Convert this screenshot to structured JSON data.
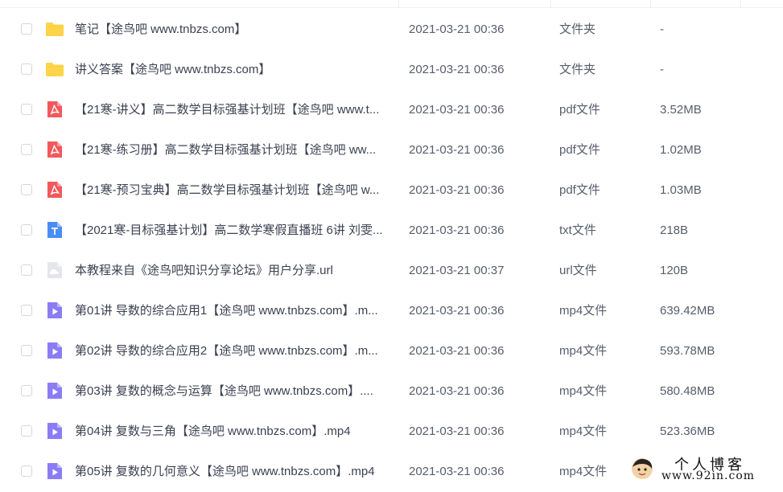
{
  "files": [
    {
      "icon": "folder-icon",
      "name": "笔记【途鸟吧 www.tnbzs.com】",
      "modified": "2021-03-21 00:36",
      "type": "文件夹",
      "size": "-"
    },
    {
      "icon": "folder-icon",
      "name": "讲义答案【途鸟吧 www.tnbzs.com】",
      "modified": "2021-03-21 00:36",
      "type": "文件夹",
      "size": "-"
    },
    {
      "icon": "pdf-icon",
      "name": "【21寒-讲义】高二数学目标强基计划班【途鸟吧 www.t...",
      "modified": "2021-03-21 00:36",
      "type": "pdf文件",
      "size": "3.52MB"
    },
    {
      "icon": "pdf-icon",
      "name": "【21寒-练习册】高二数学目标强基计划班【途鸟吧 ww...",
      "modified": "2021-03-21 00:36",
      "type": "pdf文件",
      "size": "1.02MB"
    },
    {
      "icon": "pdf-icon",
      "name": "【21寒-预习宝典】高二数学目标强基计划班【途鸟吧 w...",
      "modified": "2021-03-21 00:36",
      "type": "pdf文件",
      "size": "1.03MB"
    },
    {
      "icon": "txt-icon",
      "name": "【2021寒-目标强基计划】高二数学寒假直播班 6讲 刘雯...",
      "modified": "2021-03-21 00:36",
      "type": "txt文件",
      "size": "218B"
    },
    {
      "icon": "url-file-icon",
      "name": "本教程来自《途鸟吧知识分享论坛》用户分享.url",
      "modified": "2021-03-21 00:37",
      "type": "url文件",
      "size": "120B"
    },
    {
      "icon": "video-icon",
      "name": "第01讲 导数的综合应用1【途鸟吧 www.tnbzs.com】.m...",
      "modified": "2021-03-21 00:36",
      "type": "mp4文件",
      "size": "639.42MB"
    },
    {
      "icon": "video-icon",
      "name": "第02讲 导数的综合应用2【途鸟吧 www.tnbzs.com】.m...",
      "modified": "2021-03-21 00:36",
      "type": "mp4文件",
      "size": "593.78MB"
    },
    {
      "icon": "video-icon",
      "name": "第03讲 复数的概念与运算【途鸟吧 www.tnbzs.com】....",
      "modified": "2021-03-21 00:36",
      "type": "mp4文件",
      "size": "580.48MB"
    },
    {
      "icon": "video-icon",
      "name": "第04讲 复数与三角【途鸟吧 www.tnbzs.com】.mp4",
      "modified": "2021-03-21 00:36",
      "type": "mp4文件",
      "size": "523.36MB"
    },
    {
      "icon": "video-icon",
      "name": "第05讲 复数的几何意义【途鸟吧 www.tnbzs.com】.mp4",
      "modified": "2021-03-21 00:36",
      "type": "mp4文件",
      "size": "..."
    }
  ],
  "watermark": {
    "title": "个人博客",
    "url": "www.92in.com"
  },
  "colors": {
    "folder": "#ffd44a",
    "pdf": "#f2585b",
    "txt": "#4a8df6",
    "video": "#8b7cf6",
    "url": "#c9ced6"
  }
}
